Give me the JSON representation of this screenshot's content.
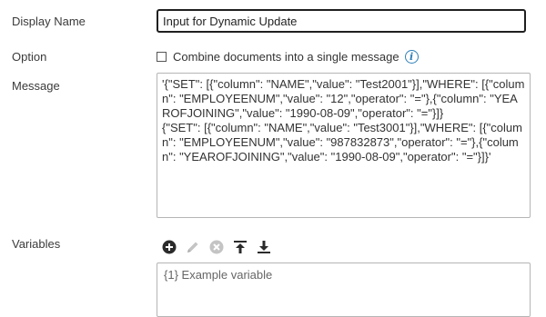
{
  "fields": {
    "display_name": {
      "label": "Display Name",
      "value": "Input for Dynamic Update"
    },
    "option": {
      "label": "Option",
      "checkbox_label": "Combine documents into a single message",
      "checked": false,
      "info_icon": "info-icon"
    },
    "message": {
      "label": "Message",
      "value": "'{\"SET\": [{\"column\": \"NAME\",\"value\": \"Test2001\"}],\"WHERE\": [{\"column\": \"EMPLOYEENUM\",\"value\": \"12\",\"operator\": \"=\"},{\"column\": \"YEAROFJOINING\",\"value\": \"1990-08-09\",\"operator\": \"=\"}]}\n{\"SET\": [{\"column\": \"NAME\",\"value\": \"Test3001\"}],\"WHERE\": [{\"column\": \"EMPLOYEENUM\",\"value\": \"987832873\",\"operator\": \"=\"},{\"column\": \"YEAROFJOINING\",\"value\": \"1990-08-09\",\"operator\": \"=\"}]}'"
    },
    "variables": {
      "label": "Variables",
      "toolbar": [
        "add-icon",
        "edit-icon",
        "remove-icon",
        "move-top-icon",
        "move-bottom-icon"
      ],
      "items": [
        "{1} Example variable"
      ]
    }
  },
  "colors": {
    "accent": "#2d7fb8",
    "icon_dark": "#2b2b2b",
    "icon_disabled": "#b8b8b8",
    "border": "#b5b5b5"
  }
}
